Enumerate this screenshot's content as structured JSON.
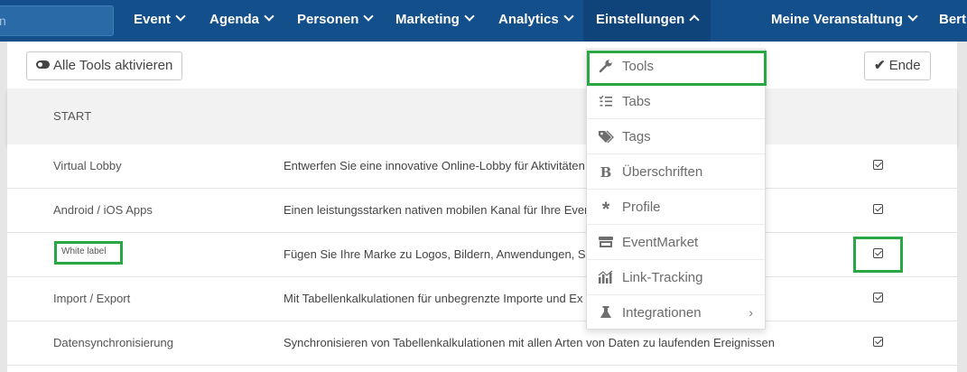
{
  "nav": {
    "search_fragment": "n",
    "items": [
      {
        "label": "Event"
      },
      {
        "label": "Agenda"
      },
      {
        "label": "Personen"
      },
      {
        "label": "Marketing"
      },
      {
        "label": "Analytics"
      },
      {
        "label": "Einstellungen"
      },
      {
        "label": "Meine Veranstaltung"
      },
      {
        "label": "Bert"
      }
    ]
  },
  "toolbar": {
    "activate_all_label": "Alle Tools aktivieren",
    "end_label": "Ende"
  },
  "section": {
    "title": "START"
  },
  "rows": [
    {
      "name": "Virtual Lobby",
      "description": "Entwerfen Sie eine innovative Online-Lobby für Aktivitäten",
      "checked": true
    },
    {
      "name": "Android / iOS Apps",
      "description": "Einen leistungsstarken nativen mobilen Kanal für Ihre Events",
      "checked": true
    },
    {
      "name": "White label",
      "description": "Fügen Sie Ihre Marke zu Logos, Bildern, Anwendungen, Se",
      "checked": true
    },
    {
      "name": "Import / Export",
      "description": "Mit Tabellenkalkulationen für unbegrenzte Importe und Ex",
      "checked": true
    },
    {
      "name": "Datensynchronisierung",
      "description": "Synchronisieren von Tabellenkalkulationen mit allen Arten von Daten zu laufenden Ereignissen",
      "checked": true
    }
  ],
  "dropdown": {
    "items": [
      {
        "label": "Tools",
        "icon": "wrench-icon"
      },
      {
        "label": "Tabs",
        "icon": "list-check-icon"
      },
      {
        "label": "Tags",
        "icon": "tags-icon"
      },
      {
        "label": "Überschriften",
        "icon": "bold-icon"
      },
      {
        "label": "Profile",
        "icon": "asterisk-icon"
      },
      {
        "label": "EventMarket",
        "icon": "store-icon"
      },
      {
        "label": "Link-Tracking",
        "icon": "chart-bars-icon"
      },
      {
        "label": "Integrationen",
        "icon": "flask-icon"
      }
    ]
  },
  "colors": {
    "nav_bg": "#134f8a",
    "highlight": "#29a744"
  }
}
